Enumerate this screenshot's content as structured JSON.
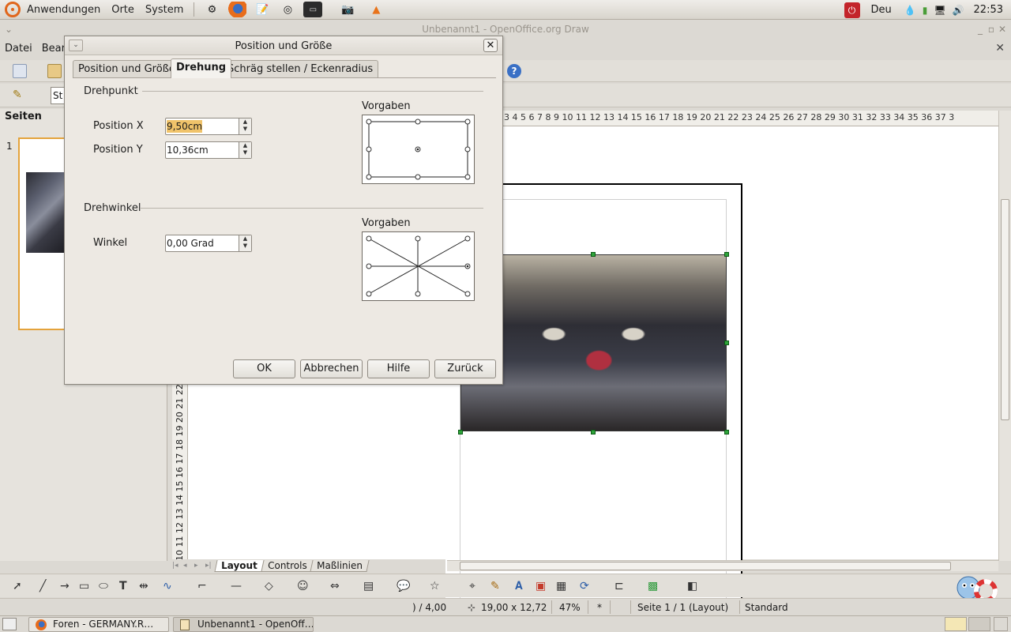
{
  "top_panel": {
    "menus": [
      "Anwendungen",
      "Orte",
      "System"
    ],
    "launchers": [
      "settings-icon",
      "firefox-icon",
      "text-editor-icon",
      "cd-burner-icon",
      "terminal-icon",
      "screenshot-icon",
      "vlc-icon"
    ],
    "keyboard_layout": "Deu",
    "clock": "22:53"
  },
  "window": {
    "title": "Unbenannt1 - OpenOffice.org Draw"
  },
  "menubar": {
    "items": [
      "Datei",
      "Bearb"
    ]
  },
  "toolbar": {
    "style_box_visible_text": "St"
  },
  "pages_pane": {
    "title": "Seiten",
    "page_number": "1"
  },
  "ruler": {
    "top_ticks": "3   4   5   6   7   8   9  10  11  12  13  14  15  16  17  18  19  20  21  22  23  24  25  26  27  28  29  30  31  32  33  34  35  36  37  3",
    "left_ticks": "10  11  12  13  14  15  16  17  18  19  20  21  22"
  },
  "layer_tabs": [
    "Layout",
    "Controls",
    "Maßlinien"
  ],
  "statusbar": {
    "position": ") / 4,00",
    "size": "19,00 x 12,72",
    "zoom": "47%",
    "modified": "*",
    "page": "Seite 1 / 1 (Layout)",
    "style": "Standard"
  },
  "taskbar": {
    "items": [
      {
        "label": "Foren - GERMANY.R…",
        "icon": "firefox-icon"
      },
      {
        "label": "Unbenannt1 - OpenOff…",
        "icon": "draw-document-icon"
      }
    ]
  },
  "dialog": {
    "title": "Position und Größe",
    "tabs": [
      "Position und Größe",
      "Drehung",
      "Schräg stellen / Eckenradius"
    ],
    "active_tab": "Drehung",
    "pivot_group": {
      "title": "Drehpunkt",
      "x_label": "Position X",
      "x_value": "9,50cm",
      "y_label": "Position Y",
      "y_value": "10,36cm",
      "preset_label": "Vorgaben"
    },
    "angle_group": {
      "title": "Drehwinkel",
      "angle_label": "Winkel",
      "angle_value": "0,00 Grad",
      "preset_label": "Vorgaben"
    },
    "buttons": {
      "ok": "OK",
      "cancel": "Abbrechen",
      "help": "Hilfe",
      "reset": "Zurück"
    }
  },
  "colors": {
    "selection_highlight": "#f0c36a",
    "handle_green": "#2ea43a",
    "thumb_border": "#e4a33c",
    "ubuntu_orange": "#e0661c"
  }
}
